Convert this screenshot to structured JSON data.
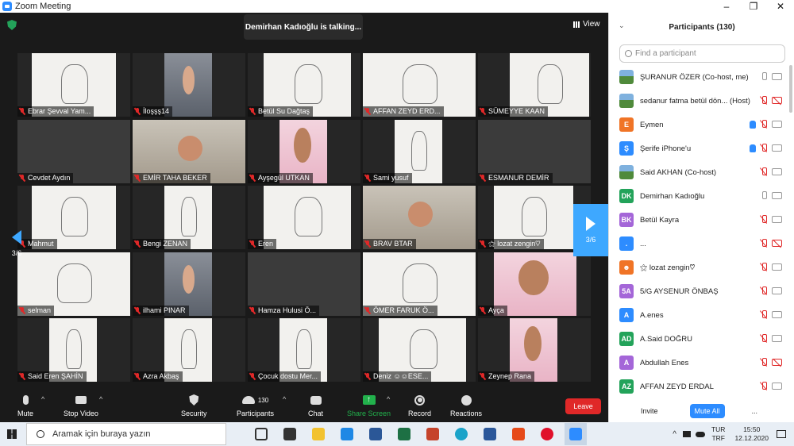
{
  "window": {
    "title": "Zoom Meeting",
    "controls": [
      "–",
      "❐",
      "✕"
    ]
  },
  "meeting": {
    "talking_banner": "Demirhan Kadıoğlu is talking...",
    "view_label": "View",
    "page_indicator_left": "3/6",
    "page_indicator_right": "3/6",
    "tiles": [
      [
        "Ebrar Şevval Yam...",
        "İloşşş14",
        "Betül Su Dağtaş",
        "AFFAN ZEYD ERD...",
        "SÜMEYYE KAAN"
      ],
      [
        "Cevdet Aydın",
        "EMİR TAHA BEKER",
        "Ayşegül UTKAN",
        "Sami yusuf",
        "ESMANUR DEMİR"
      ],
      [
        "Mahmut",
        "Bengi ZENAN",
        "Eren",
        "BRAV BTAR",
        "⚝ lozat zengin♡"
      ],
      [
        "selman",
        "ilhami PINAR",
        "Hamza Hulusi Ö...",
        "ÖMER FARUK Ö...",
        "Ayça"
      ],
      [
        "Said Eren ŞAHİN",
        "Azra Akbaş",
        "Çocuk dostu Mer...",
        "Deniz ☺☺ESE...",
        "Zeynep Rana"
      ]
    ]
  },
  "toolbar": {
    "mute": "Mute",
    "stop_video": "Stop Video",
    "security": "Security",
    "participants": "Participants",
    "participants_count": "130",
    "chat": "Chat",
    "share_screen": "Share Screen",
    "record": "Record",
    "reactions": "Reactions",
    "leave": "Leave",
    "share_color": "#22b14c",
    "leave_color": "#e02828"
  },
  "panel": {
    "title": "Participants (130)",
    "search_placeholder": "Find a participant",
    "participants": [
      {
        "name": "ŞURANUR ÖZER (Co-host, me)",
        "initials": "",
        "color": "photo",
        "mic": "on",
        "cam": "on",
        "hand": false
      },
      {
        "name": "sedanur fatma betül dön... (Host)",
        "initials": "",
        "color": "photo",
        "mic": "off",
        "cam": "off",
        "hand": false
      },
      {
        "name": "Eymen",
        "initials": "E",
        "color": "#f07426",
        "mic": "off",
        "cam": "on",
        "hand": true
      },
      {
        "name": "Şerife iPhone'u",
        "initials": "Ş",
        "color": "#2d8cff",
        "mic": "off",
        "cam": "on",
        "hand": true
      },
      {
        "name": "Said AKHAN (Co-host)",
        "initials": "",
        "color": "photo",
        "mic": "off",
        "cam": "on",
        "hand": false
      },
      {
        "name": "Demirhan Kadıoğlu",
        "initials": "DK",
        "color": "#23a35a",
        "mic": "on",
        "cam": "on",
        "hand": false
      },
      {
        "name": "Betül Kayra",
        "initials": "BK",
        "color": "#a466d8",
        "mic": "off",
        "cam": "on",
        "hand": false
      },
      {
        "name": "...",
        "initials": ".",
        "color": "#2d8cff",
        "mic": "off",
        "cam": "off",
        "hand": false
      },
      {
        "name": "⚝ lozat zengin♡",
        "initials": "☻",
        "color": "#f07426",
        "mic": "off",
        "cam": "on",
        "hand": false
      },
      {
        "name": "5/G AYSENUR ÖNBAŞ",
        "initials": "5A",
        "color": "#a466d8",
        "mic": "off",
        "cam": "on",
        "hand": false
      },
      {
        "name": "A.enes",
        "initials": "A",
        "color": "#2d8cff",
        "mic": "off",
        "cam": "on",
        "hand": false
      },
      {
        "name": "A.Said DOĞRU",
        "initials": "AD",
        "color": "#23a35a",
        "mic": "off",
        "cam": "on",
        "hand": false
      },
      {
        "name": "Abdullah Enes",
        "initials": "A",
        "color": "#a466d8",
        "mic": "off",
        "cam": "off",
        "hand": false
      },
      {
        "name": "AFFAN ZEYD ERDAL",
        "initials": "AZ",
        "color": "#23a35a",
        "mic": "off",
        "cam": "on",
        "hand": false
      }
    ],
    "invite": "Invite",
    "mute_all": "Mute All",
    "more": "..."
  },
  "taskbar": {
    "search_placeholder": "Aramak için buraya yazın",
    "lang_top": "TUR",
    "lang_bottom": "TRF",
    "time": "15:50",
    "date": "12.12.2020"
  }
}
